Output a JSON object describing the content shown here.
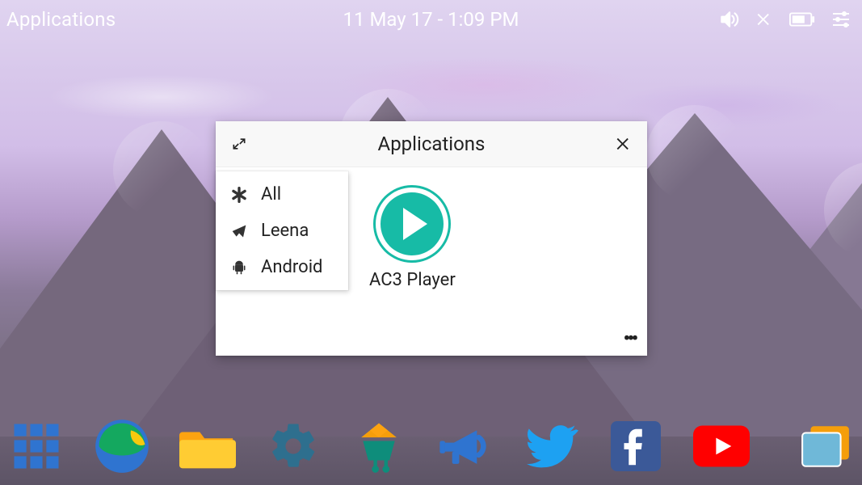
{
  "topbar": {
    "applications_label": "Applications",
    "datetime": "11 May 17 - 1:09 PM"
  },
  "panel": {
    "title": "Applications",
    "categories": [
      {
        "icon": "asterisk",
        "label": "All"
      },
      {
        "icon": "paper-plane",
        "label": "Leena"
      },
      {
        "icon": "android",
        "label": "Android"
      }
    ],
    "apps": [
      {
        "name": "AC3 Player"
      }
    ]
  },
  "dock": {
    "items": [
      "app-drawer",
      "browser",
      "files",
      "settings",
      "store",
      "announcements",
      "twitter",
      "facebook",
      "youtube",
      "multitask"
    ]
  }
}
